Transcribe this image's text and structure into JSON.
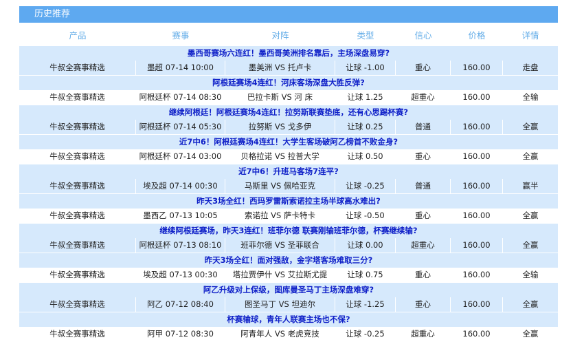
{
  "panel": {
    "title": "历史推荐",
    "columns": [
      "产品",
      "赛事",
      "对阵",
      "类型",
      "信心",
      "价格",
      "详情"
    ]
  },
  "records": [
    {
      "headline": "墨西哥赛场六连红！墨西哥美洲排名靠后，主场深盘易穿?",
      "product": "牛叔全赛事精选",
      "event": "墨超 07-14 10:00",
      "match": "墨美洲 VS 托卢卡",
      "type": "让球 -1.00",
      "confidence": "重心",
      "price": "160.00",
      "result": "走盘"
    },
    {
      "headline": "阿根廷赛场4连红！河床客场深盘大胜反弹?",
      "product": "牛叔全赛事精选",
      "event": "阿根廷杯 07-14 08:30",
      "match": "巴拉卡斯 VS 河 床",
      "type": "让球 1.25",
      "confidence": "超重心",
      "price": "160.00",
      "result": "全输"
    },
    {
      "headline": "继续阿根廷！阿根廷赛场4连红！拉努斯联赛垫底，还有心思踢杯赛?",
      "product": "牛叔全赛事精选",
      "event": "阿根廷杯 07-14 05:30",
      "match": "拉努斯 VS 戈多伊",
      "type": "让球 0.25",
      "confidence": "普通",
      "price": "160.00",
      "result": "全赢"
    },
    {
      "headline": "近7中6！阿根廷赛场4连红！大学生客场破阿乙榜首不败金身?",
      "product": "牛叔全赛事精选",
      "event": "阿根廷杯 07-14 03:00",
      "match": "贝格拉诺 VS 拉普大学",
      "type": "让球 0.50",
      "confidence": "重心",
      "price": "160.00",
      "result": "全赢"
    },
    {
      "headline": "近7中6！升班马客场7连平?",
      "product": "牛叔全赛事精选",
      "event": "埃及超 07-14 00:30",
      "match": "马斯里 VS 佩哈亚克",
      "type": "让球 -0.25",
      "confidence": "普通",
      "price": "160.00",
      "result": "赢半"
    },
    {
      "headline": "昨天3场全红！西玛罗雷斯索诺拉主场半球高水难出?",
      "product": "牛叔全赛事精选",
      "event": "墨西乙 07-13 10:05",
      "match": "索诺拉 VS 萨卡特卡",
      "type": "让球 -0.50",
      "confidence": "重心",
      "price": "160.00",
      "result": "全赢"
    },
    {
      "headline": "继续阿根廷赛场，昨天3连红！班菲尔德 联赛刚输班菲尔德，杯赛继续输?",
      "product": "牛叔全赛事精选",
      "event": "阿根廷杯 07-13 08:10",
      "match": "班菲尔德 VS 圣菲联合",
      "type": "让球 0.00",
      "confidence": "超重心",
      "price": "160.00",
      "result": "全赢"
    },
    {
      "headline": "昨天3场全红！面对强敌，金字塔客场难取三分?",
      "product": "牛叔全赛事精选",
      "event": "埃及超 07-13 00:30",
      "match": "塔拉贾伊什 VS 艾拉斯尤提",
      "type": "让球 0.75",
      "confidence": "重心",
      "price": "160.00",
      "result": "全输"
    },
    {
      "headline": "阿乙升级对上保级，图库曼圣马丁主场深盘难穿?",
      "product": "牛叔全赛事精选",
      "event": "阿乙 07-12 08:40",
      "match": "图圣马丁 VS 坦迪尔",
      "type": "让球 -1.25",
      "confidence": "重心",
      "price": "160.00",
      "result": "全赢"
    },
    {
      "headline": "杯赛输球，青年人联赛主场也不保?",
      "product": "牛叔全赛事精选",
      "event": "阿甲 07-12 08:30",
      "match": "阿青年人 VS 老虎竞技",
      "type": "让球 -0.25",
      "confidence": "超重心",
      "price": "160.00",
      "result": "全赢"
    }
  ]
}
